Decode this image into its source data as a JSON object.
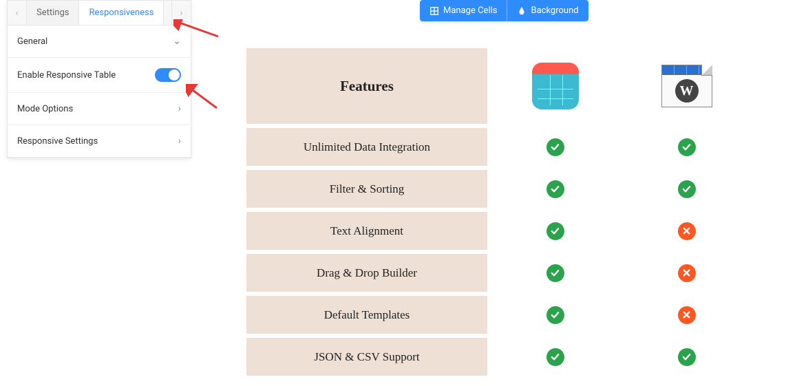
{
  "toolbar": {
    "manage_cells": "Manage Cells",
    "background": "Background"
  },
  "sidebar": {
    "tabs": {
      "settings": "Settings",
      "responsiveness": "Responsiveness"
    },
    "sections": {
      "general": "General",
      "enable_responsive": "Enable Responsive Table",
      "mode_options": "Mode Options",
      "responsive_settings": "Responsive Settings"
    }
  },
  "table": {
    "header": "Features",
    "rows": [
      {
        "feature": "Unlimited Data Integration",
        "a": true,
        "b": true
      },
      {
        "feature": "Filter & Sorting",
        "a": true,
        "b": true
      },
      {
        "feature": "Text Alignment",
        "a": true,
        "b": false
      },
      {
        "feature": "Drag & Drop Builder",
        "a": true,
        "b": false
      },
      {
        "feature": "Default Templates",
        "a": true,
        "b": false
      },
      {
        "feature": "JSON & CSV Support",
        "a": true,
        "b": true
      }
    ]
  }
}
